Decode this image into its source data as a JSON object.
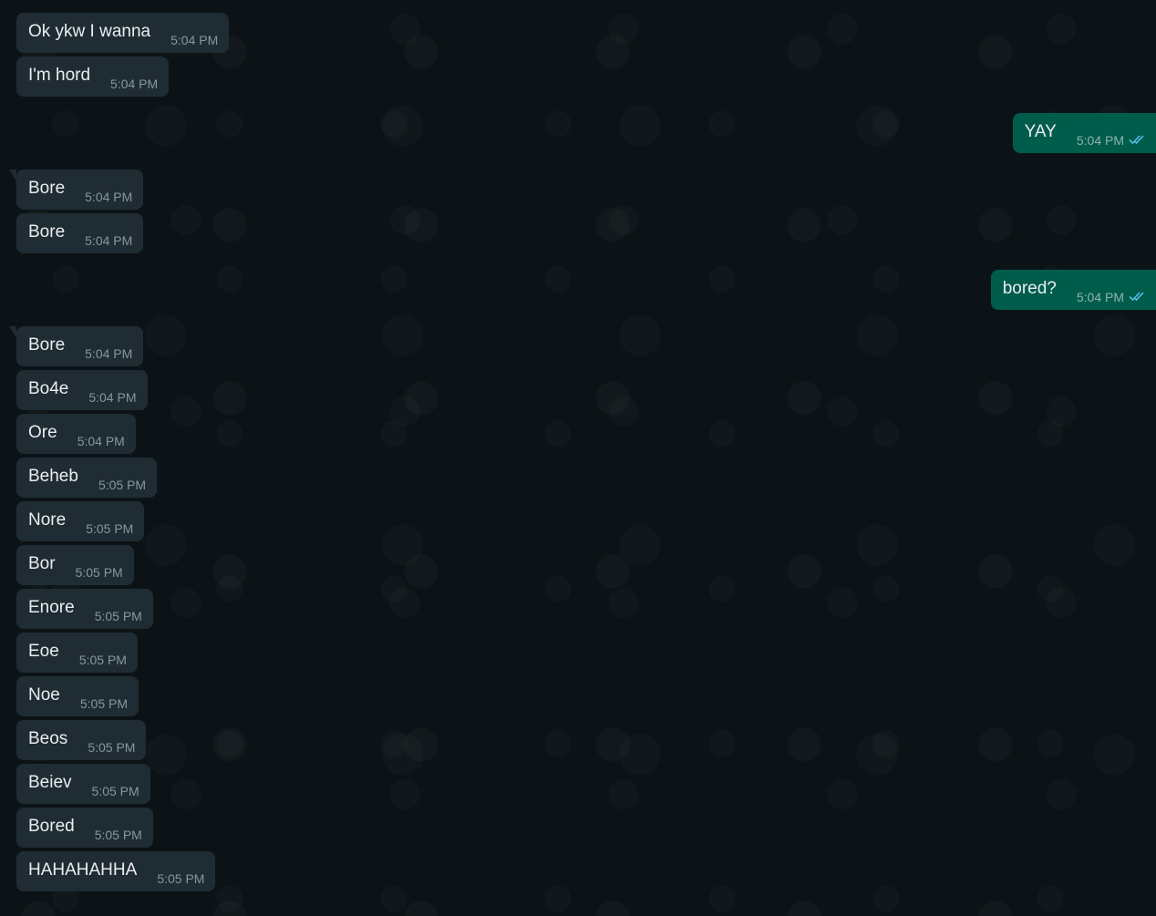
{
  "accent": {
    "incoming_bubble": "#202c33",
    "outgoing_bubble": "#005c4b",
    "read_ticks": "#53bdeb",
    "background": "#0c1317"
  },
  "messages": [
    {
      "dir": "in",
      "text": "Ok ykw I wanna",
      "time": "5:04 PM"
    },
    {
      "dir": "in",
      "text": "I'm hord",
      "time": "5:04 PM"
    },
    {
      "dir": "out",
      "text": "YAY",
      "time": "5:04 PM",
      "status_icon": "double-check-read-icon"
    },
    {
      "dir": "in",
      "text": "Bore",
      "time": "5:04 PM"
    },
    {
      "dir": "in",
      "text": "Bore",
      "time": "5:04 PM"
    },
    {
      "dir": "out",
      "text": "bored?",
      "time": "5:04 PM",
      "status_icon": "double-check-read-icon"
    },
    {
      "dir": "in",
      "text": "Bore",
      "time": "5:04 PM"
    },
    {
      "dir": "in",
      "text": "Bo4e",
      "time": "5:04 PM"
    },
    {
      "dir": "in",
      "text": "Ore",
      "time": "5:04 PM"
    },
    {
      "dir": "in",
      "text": "Beheb",
      "time": "5:05 PM"
    },
    {
      "dir": "in",
      "text": "Nore",
      "time": "5:05 PM"
    },
    {
      "dir": "in",
      "text": "Bor",
      "time": "5:05 PM"
    },
    {
      "dir": "in",
      "text": "Enore",
      "time": "5:05 PM"
    },
    {
      "dir": "in",
      "text": "Eoe",
      "time": "5:05 PM"
    },
    {
      "dir": "in",
      "text": "Noe",
      "time": "5:05 PM"
    },
    {
      "dir": "in",
      "text": "Beos",
      "time": "5:05 PM"
    },
    {
      "dir": "in",
      "text": "Beiev",
      "time": "5:05 PM"
    },
    {
      "dir": "in",
      "text": "Bored",
      "time": "5:05 PM"
    },
    {
      "dir": "in",
      "text": "HAHAHAHHA",
      "time": "5:05 PM"
    }
  ]
}
